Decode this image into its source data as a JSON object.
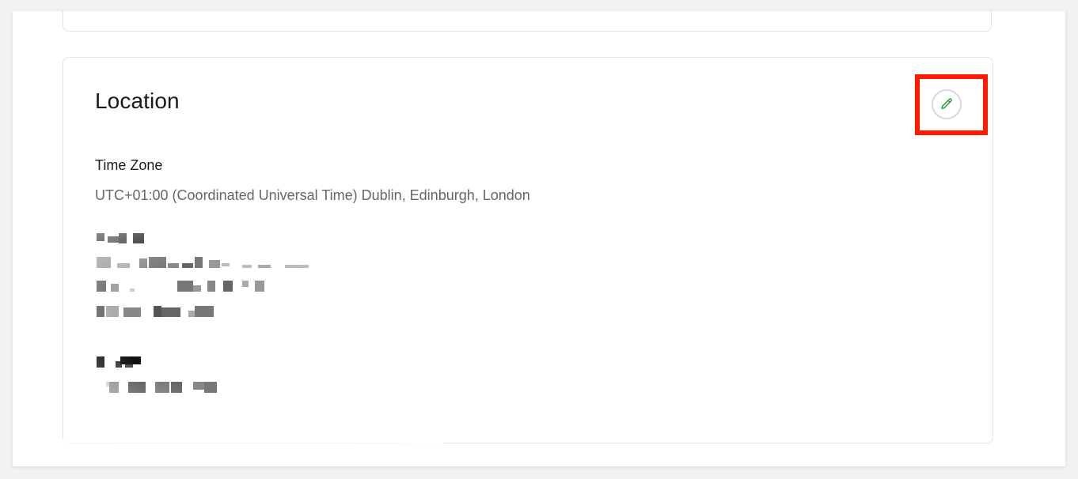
{
  "location": {
    "title": "Location",
    "time_zone_label": "Time Zone",
    "time_zone_value": "UTC+01:00 (Coordinated Universal Time) Dublin, Edinburgh, London"
  },
  "icons": {
    "edit": "pencil-icon"
  },
  "colors": {
    "highlight": "#ff1a00",
    "edit_icon": "#2e9e2e",
    "secondary_text": "#666666"
  }
}
